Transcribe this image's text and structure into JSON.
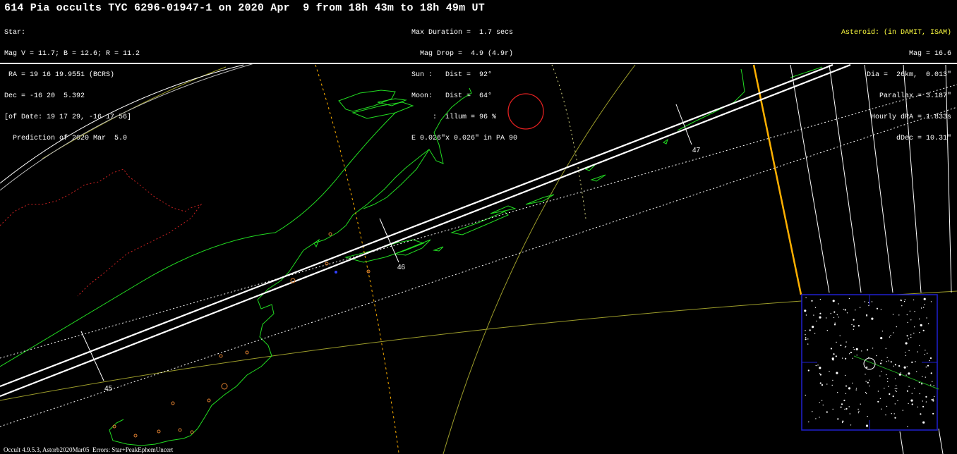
{
  "header": {
    "title": "614 Pia occults TYC 6296-01947-1 on 2020 Apr  9 from 18h 43m to 18h 49m UT",
    "star_lines": [
      "Star:",
      "Mag V = 11.7; B = 12.6; R = 11.2",
      " RA = 19 16 19.9551 (BCRS)",
      "Dec = -16 20  5.392",
      "[of Date: 19 17 29, -16 17 56]",
      "  Prediction of 2020 Mar  5.0"
    ],
    "event_lines": [
      "Max Duration =  1.7 secs",
      "  Mag Drop =  4.9 (4.9r)",
      "Sun :   Dist =  92°",
      "Moon:   Dist =  64°",
      "     :  illum = 96 %",
      "E 0.026\"x 0.026\" in PA 90"
    ],
    "asteroid_label": "Asteroid: (in DAMIT, ISAM)",
    "asteroid_lines": [
      "Mag = 16.6",
      "Dia =  26km,  0.013\"",
      "Parallax = 3.187\"",
      "Hourly dRA = 1.833s",
      "dDec = 10.31\""
    ]
  },
  "map": {
    "time_ticks": [
      "45",
      "46",
      "47"
    ],
    "colors": {
      "path": "#ffffff",
      "coast": "#22dd22",
      "border": "#cc2222",
      "sunrise": "#ffb000",
      "grid": "#9c9c2a",
      "starchart_frame": "#2020d0"
    }
  },
  "footer": "Occult 4.9.5.3, Astorb2020Mar05  Errors: Star+PeakEphemUncert"
}
